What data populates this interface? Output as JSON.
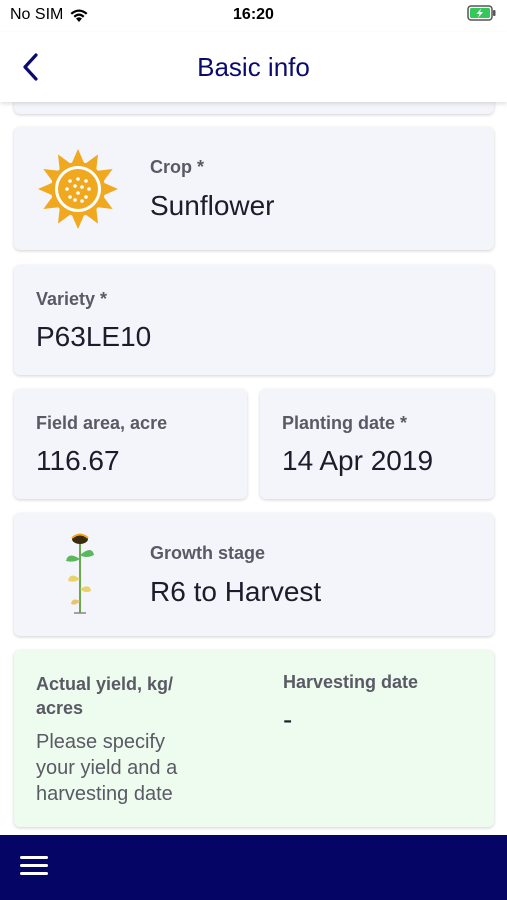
{
  "status": {
    "carrier": "No SIM",
    "time": "16:20",
    "wifi_icon": "wifi-icon",
    "battery_icon": "battery-charging-icon"
  },
  "nav": {
    "title": "Basic info",
    "back_icon": "chevron-left-icon"
  },
  "crop": {
    "label": "Crop *",
    "value": "Sunflower",
    "icon": "sunflower-icon"
  },
  "variety": {
    "label": "Variety *",
    "value": "P63LE10"
  },
  "field_area": {
    "label": "Field area, acre",
    "value": "116.67"
  },
  "planting_date": {
    "label": "Planting date *",
    "value": "14 Apr 2019"
  },
  "growth_stage": {
    "label": "Growth stage",
    "value": "R6 to Harvest",
    "icon": "sunflower-plant-icon"
  },
  "yield": {
    "label_line1": "Actual yield, kg/",
    "label_line2": "acres",
    "hint_line1": "Please specify",
    "hint_line2": "your yield and a",
    "hint_line3": "harvesting date",
    "harvest_label": "Harvesting date",
    "harvest_value": "-"
  },
  "bottom": {
    "menu_icon": "hamburger-menu-icon"
  },
  "colors": {
    "accent": "#050566",
    "card": "#f4f4fb",
    "yield_card": "#eefbef"
  }
}
